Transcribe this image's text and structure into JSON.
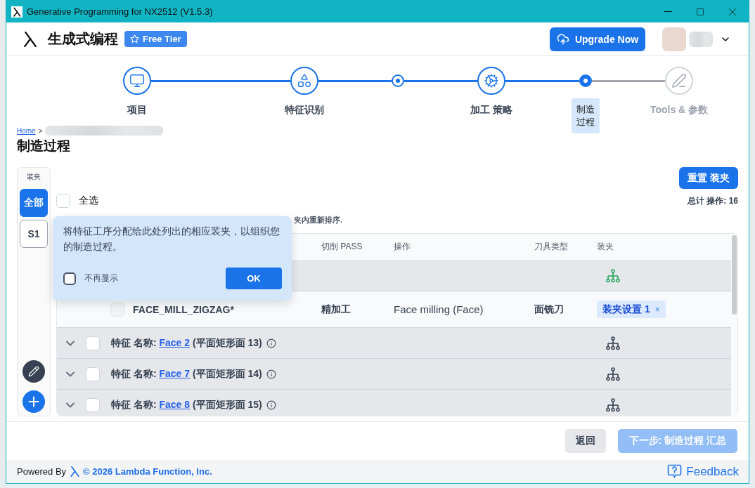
{
  "window": {
    "title": "Generative Programming for NX2512 (V1.5.3)"
  },
  "header": {
    "app_name": "生成式编程",
    "badge": "Free Tier",
    "upgrade_button": "Upgrade Now"
  },
  "stepper": [
    {
      "label": "项目",
      "kind": "icon",
      "completed": true,
      "active": false
    },
    {
      "label": "特征识别",
      "kind": "icon",
      "completed": true,
      "active": false
    },
    {
      "kind": "dot",
      "completed": true,
      "active": false
    },
    {
      "label": "加工 策略",
      "kind": "icon",
      "completed": true,
      "active": false
    },
    {
      "label": "制造过程",
      "kind": "dot",
      "completed": false,
      "active": true
    },
    {
      "label": "Tools & 参数",
      "kind": "icon",
      "completed": false,
      "active": false
    }
  ],
  "breadcrumb": {
    "home": "Home",
    "separator": ">"
  },
  "page_title": "制造过程",
  "fixture_panel": {
    "title": "装夹",
    "items": [
      {
        "label": "全部",
        "selected": true
      },
      {
        "label": "S1",
        "selected": false
      }
    ]
  },
  "select_all": {
    "label": "全选",
    "checked": false
  },
  "reorder_hint": "夹内重新排序.",
  "reset_button": "重置 装夹",
  "total_operations": "总计 操作: 16",
  "table": {
    "columns": [
      "切削 PASS",
      "操作",
      "刀具类型",
      "装夹"
    ],
    "rows": [
      {
        "kind": "feature",
        "assigned": true
      },
      {
        "kind": "operation",
        "checked": false,
        "disabled": true,
        "name": "FACE_MILL_ZIGZAG*",
        "cut_pass": "精加工",
        "operation": "Face milling (Face)",
        "tool_type": "面铣刀",
        "fixture": {
          "label": "装夹设置 1",
          "remove": "×"
        }
      },
      {
        "kind": "feature",
        "checked": false,
        "assigned": false,
        "prefix": "特征 名称:",
        "link": "Face 2",
        "detail": "(平面矩形面 13)"
      },
      {
        "kind": "feature",
        "checked": false,
        "assigned": false,
        "prefix": "特征 名称:",
        "link": "Face 7",
        "detail": "(平面矩形面 14)"
      },
      {
        "kind": "feature",
        "checked": false,
        "assigned": false,
        "prefix": "特征 名称:",
        "link": "Face 8",
        "detail": "(平面矩形面 15)"
      }
    ]
  },
  "popover": {
    "text": "将特征工序分配给此处列出的相应装夹，以组织您的制造过程。",
    "dont_show": {
      "label": "不再显示",
      "checked": false
    },
    "ok_button": "OK"
  },
  "footer": {
    "back_button": "返回",
    "next_button": {
      "label": "下一步: 制造过程 汇总",
      "disabled": true
    }
  },
  "status_bar": {
    "powered_by": "Powered By",
    "copyright": "© 2026 Lambda Function, Inc.",
    "feedback": "Feedback"
  }
}
